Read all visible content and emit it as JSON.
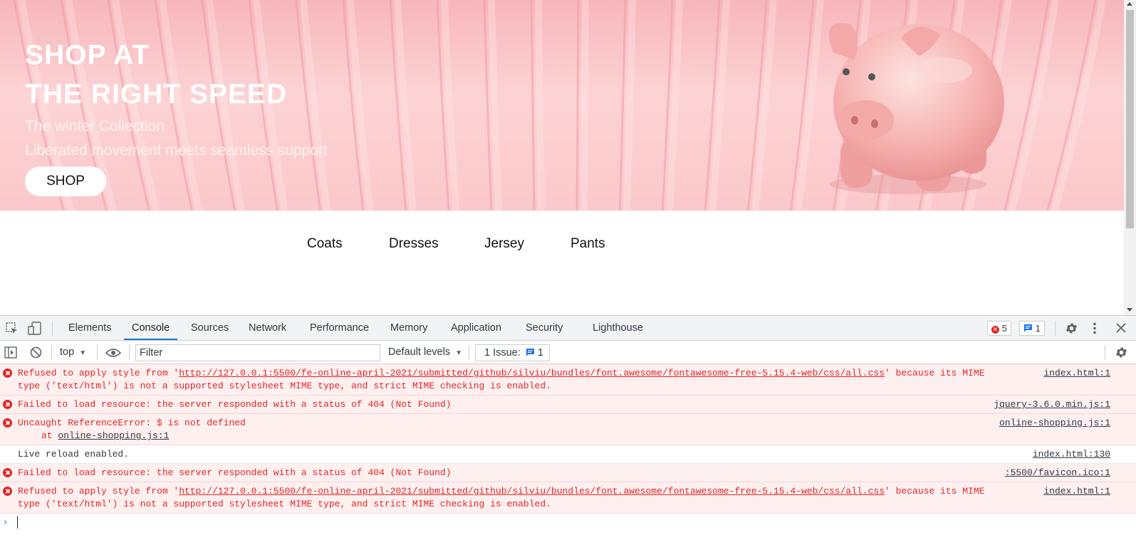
{
  "hero": {
    "title_line1": "SHOP AT",
    "title_line2": "THE RIGHT SPEED",
    "subtitle1": "The winter Collection",
    "subtitle2": "Liberated movement meets seamless support",
    "shop_button": "SHOP"
  },
  "categories": [
    "Coats",
    "Dresses",
    "Jersey",
    "Pants"
  ],
  "devtools": {
    "tabs": [
      "Elements",
      "Console",
      "Sources",
      "Network",
      "Performance",
      "Memory",
      "Application",
      "Security",
      "Lighthouse"
    ],
    "active_tab": "Console",
    "error_count": "5",
    "message_count": "1",
    "toolbar": {
      "context": "top",
      "filter_placeholder": "Filter",
      "levels": "Default levels",
      "issues_label": "1 Issue:",
      "issues_count": "1"
    },
    "messages": [
      {
        "type": "error",
        "prefix": "Refused to apply style from '",
        "link": "http://127.0.0.1:5500/fe-online-april-2021/submitted/github/silviu/bundles/font.awesome/fontawesome-free-5.15.4-web/css/all.css",
        "suffix": "' because its MIME type ('text/html') is not a supported stylesheet MIME type, and strict MIME checking is enabled.",
        "source": "index.html:1"
      },
      {
        "type": "error",
        "text": "Failed to load resource: the server responded with a status of 404 (Not Found)",
        "source": "jquery-3.6.0.min.js:1"
      },
      {
        "type": "error",
        "text": "Uncaught ReferenceError: $ is not defined",
        "stack_prefix": "at ",
        "stack_link": "online-shopping.js:1",
        "source": "online-shopping.js:1"
      },
      {
        "type": "info",
        "text": "Live reload enabled.",
        "source": "index.html:130"
      },
      {
        "type": "error",
        "text": "Failed to load resource: the server responded with a status of 404 (Not Found)",
        "source": ":5500/favicon.ico:1"
      },
      {
        "type": "error",
        "prefix": "Refused to apply style from '",
        "link": "http://127.0.0.1:5500/fe-online-april-2021/submitted/github/silviu/bundles/font.awesome/fontawesome-free-5.15.4-web/css/all.css",
        "suffix": "' because its MIME type ('text/html') is not a supported stylesheet MIME type, and strict MIME checking is enabled.",
        "source": "index.html:1"
      }
    ]
  },
  "colors": {
    "hero_pink": "#f7b6bb",
    "error_red": "#e22525",
    "error_bg": "#fff0f0",
    "accent_blue": "#1a73e8"
  },
  "icons": [
    "inspect-icon",
    "device-toggle-icon",
    "error-circle-icon",
    "message-icon",
    "gear-icon",
    "kebab-menu-icon",
    "close-icon",
    "sidebar-toggle-icon",
    "clear-console-icon",
    "eye-icon",
    "chevron-down-icon",
    "prompt-chevron-icon",
    "pig-illustration"
  ]
}
